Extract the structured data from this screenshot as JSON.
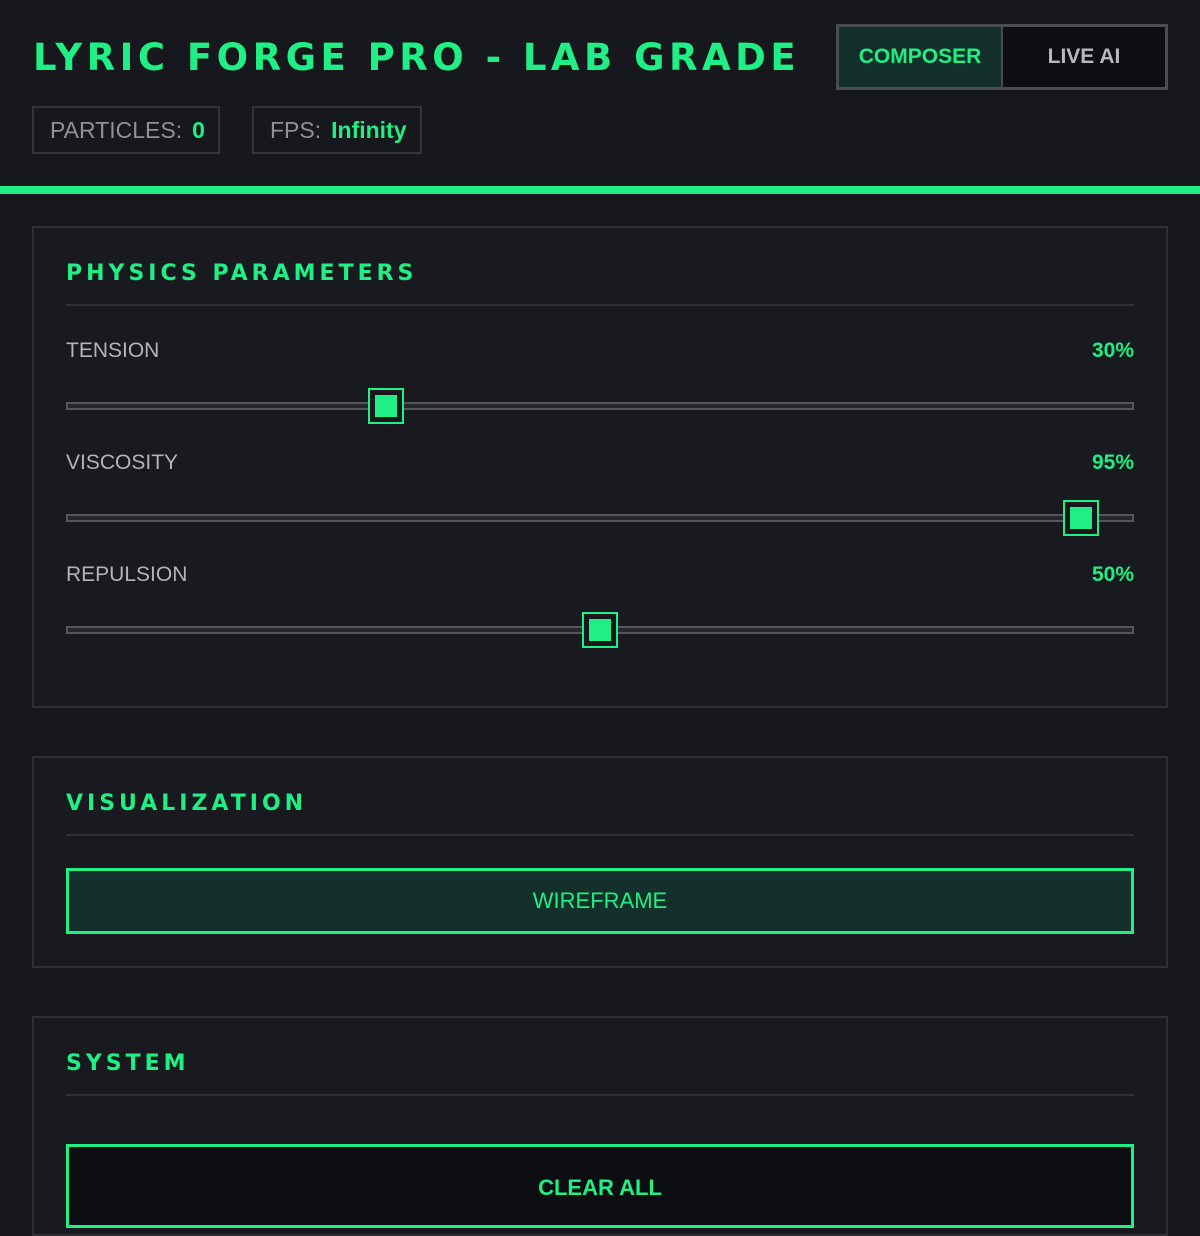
{
  "header": {
    "title": "LYRIC FORGE PRO - LAB GRADE",
    "modes": {
      "composer_label": "COMPOSER",
      "live_ai_label": "LIVE AI",
      "active": "composer"
    },
    "stats": {
      "particles_label": "PARTICLES:",
      "particles_value": "0",
      "fps_label": "FPS:",
      "fps_value": "Infinity"
    }
  },
  "physics": {
    "title": "PHYSICS PARAMETERS",
    "params": [
      {
        "label": "TENSION",
        "value_text": "30%",
        "value": 30
      },
      {
        "label": "VISCOSITY",
        "value_text": "95%",
        "value": 95
      },
      {
        "label": "REPULSION",
        "value_text": "50%",
        "value": 50
      }
    ]
  },
  "visualization": {
    "title": "VISUALIZATION",
    "mode_button_label": "WIREFRAME"
  },
  "system": {
    "title": "SYSTEM",
    "clear_button_label": "CLEAR ALL"
  },
  "colors": {
    "accent": "#1fef84",
    "background": "#17181d",
    "panel_border": "#2e3036"
  }
}
